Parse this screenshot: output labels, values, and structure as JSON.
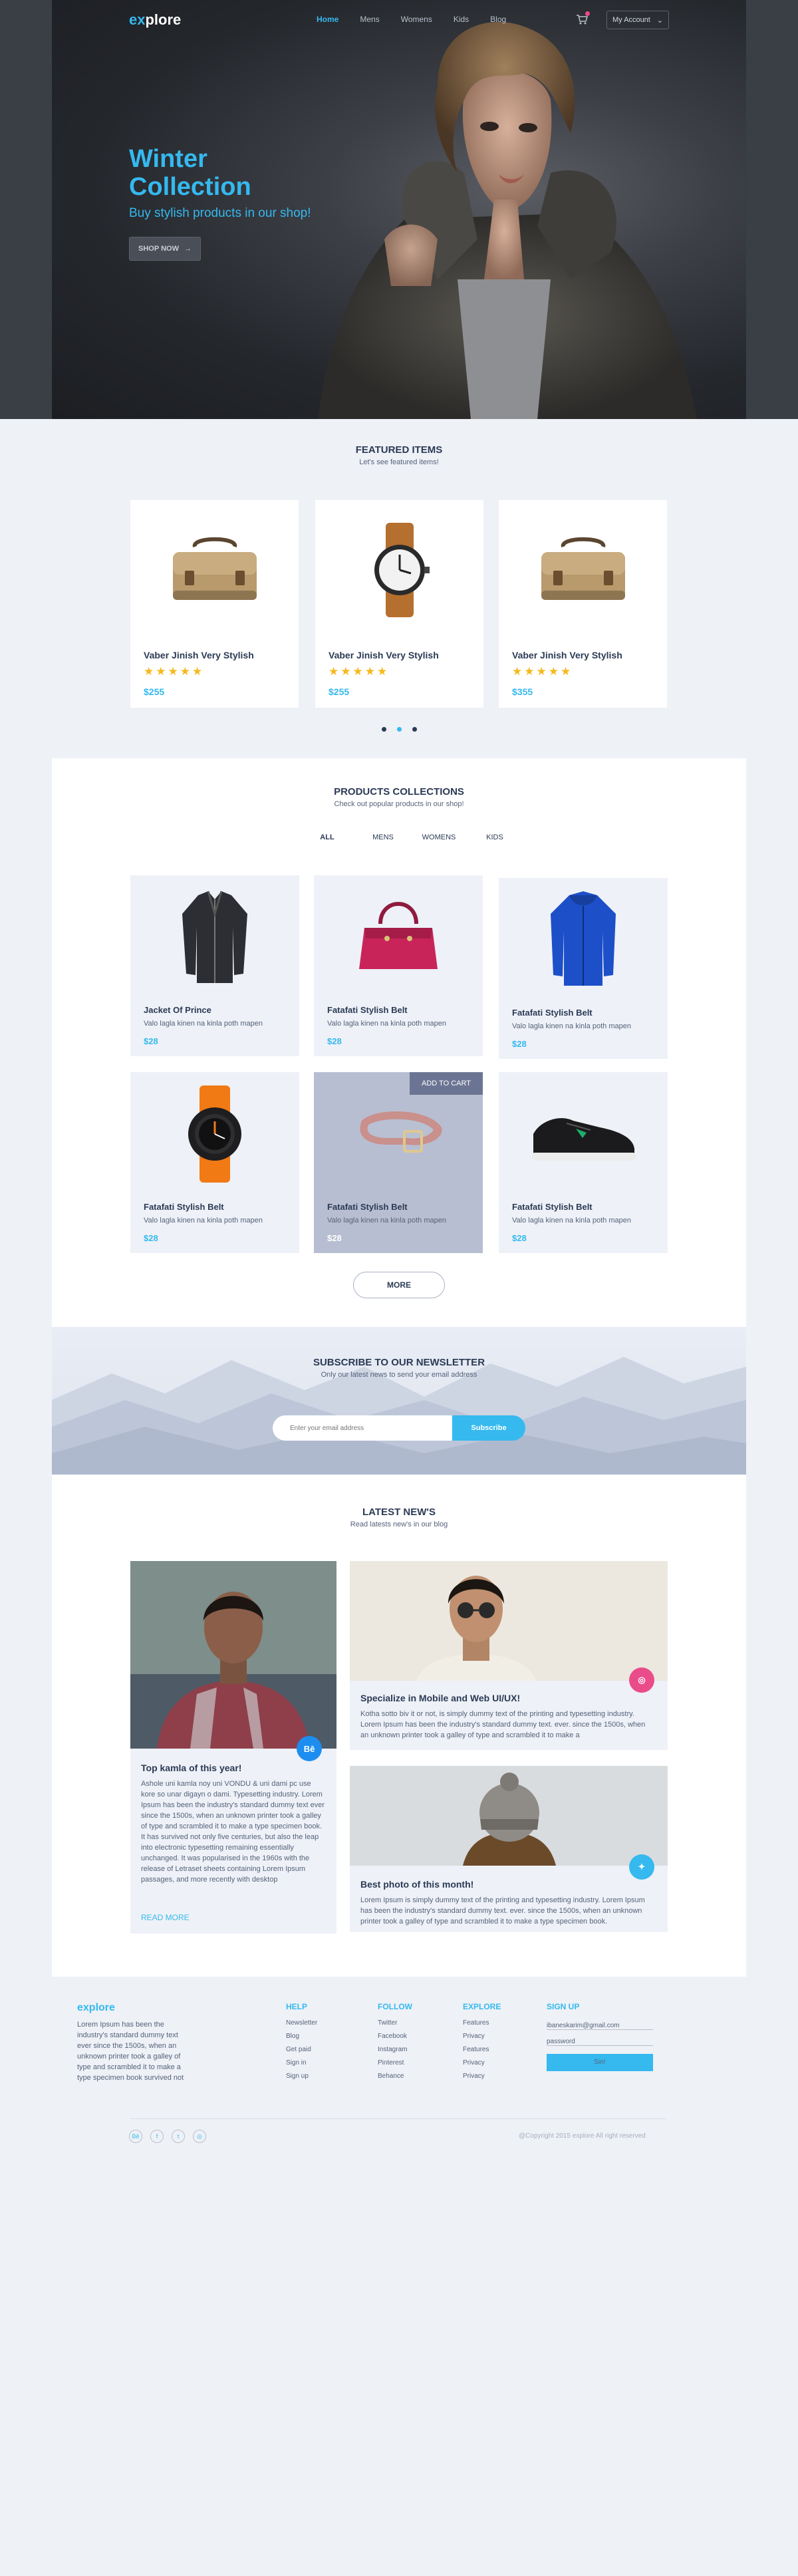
{
  "nav": {
    "logo_a": "ex",
    "logo_b": "plore",
    "links": [
      "Home",
      "Mens",
      "Womens",
      "Kids",
      "Blog"
    ],
    "account": "My Account",
    "account_caret": "⌄"
  },
  "hero": {
    "title_line1": "Winter",
    "title_line2": "Collection",
    "subtitle": "Buy stylish products in our shop!",
    "button": "SHOP NOW",
    "button_arrow": "→"
  },
  "featured": {
    "title": "FEATURED ITEMS",
    "subtitle": "Let's see featured items!",
    "items": [
      {
        "name": "Vaber Jinish Very Stylish",
        "stars": "★★★★★",
        "rating": 5,
        "price": "$255",
        "icon": "messenger-bag-icon"
      },
      {
        "name": "Vaber Jinish Very Stylish",
        "stars": "★★★★★",
        "rating": 5,
        "price": "$255",
        "icon": "wristwatch-icon"
      },
      {
        "name": "Vaber Jinish Very Stylish",
        "stars": "★★★★★",
        "rating": 5,
        "price": "$355",
        "icon": "messenger-bag-icon"
      }
    ],
    "active_dot": 2
  },
  "products": {
    "title": "PRODUCTS COLLECTIONS",
    "subtitle": "Check out popular products in our shop!",
    "filters": [
      "ALL",
      "MENS",
      "WOMENS",
      "KIDS"
    ],
    "add_to_cart": "ADD TO CART",
    "more": "MORE",
    "items": [
      {
        "name": "Jacket Of Prince",
        "desc": "Valo lagla kinen na kinla poth mapen",
        "price": "$28",
        "icon": "leather-jacket-icon"
      },
      {
        "name": "Fatafati Stylish Belt",
        "desc": "Valo lagla kinen na kinla poth mapen",
        "price": "$28",
        "icon": "handbag-icon"
      },
      {
        "name": "Fatafati Stylish Belt",
        "desc": "Valo lagla kinen na kinla poth mapen",
        "price": "$28",
        "icon": "blue-jacket-icon"
      },
      {
        "name": "Fatafati Stylish Belt",
        "desc": "Valo lagla kinen na kinla poth mapen",
        "price": "$28",
        "icon": "sport-watch-icon"
      },
      {
        "name": "Fatafati Stylish Belt",
        "desc": "Valo lagla kinen na kinla poth mapen",
        "price": "$28",
        "icon": "belt-icon"
      },
      {
        "name": "Fatafati Stylish Belt",
        "desc": "Valo lagla kinen na kinla poth mapen",
        "price": "$28",
        "icon": "sneaker-icon"
      }
    ]
  },
  "newsletter": {
    "title": "SUBSCRIBE TO OUR NEWSLETTER",
    "subtitle": "Only our latest news to send your email address",
    "placeholder": "Enter your email address",
    "button": "Subscribe"
  },
  "news": {
    "title": "LATEST NEW'S",
    "subtitle": "Read latests new's in our blog",
    "posts": [
      {
        "title": "Top kamla of this year!",
        "body": "Ashole uni kamla noy uni VONDU & uni dami pc use kore so unar digayn o dami. Typesetting industry. Lorem Ipsum has been the industry's standard dummy text ever since the 1500s, when an unknown printer took a galley of type and scrambled it to make a type specimen book. It has survived not only five centuries, but also the leap into electronic typesetting remaining essentially unchanged. It was popularised in the 1960s with the release of Letraset sheets containing Lorem Ipsum passages, and more recently with desktop",
        "badge": "Bē",
        "read_more": "READ MORE"
      },
      {
        "title": "Specialize in Mobile and Web UI/UX!",
        "body": "Kotha sotto biv it or not, is simply dummy text of the printing and typesetting industry. Lorem Ipsum has been the industry's standard dummy text. ever. since the 1500s, when an unknown printer took a galley of type and scrambled it to make a",
        "badge": "◎"
      },
      {
        "title": "Best photo of this month!",
        "body": "Lorem Ipsum is simply dummy text of the printing and typesetting industry. Lorem Ipsum has been the industry's standard dummy text. ever. since the 1500s, when an unknown printer took a galley of type and scrambled it to make a type specimen book.",
        "badge": "✦"
      }
    ]
  },
  "footer": {
    "logo": "explore",
    "about": "Lorem Ipsum has been the industry's standard dummy text ever since the 1500s, when an unknown printer took a galley of type and scrambled it to make a type specimen book survived not",
    "help": {
      "title": "HELP",
      "items": [
        "Newsletter",
        "Blog",
        "Get paid",
        "Sign in",
        "Sign up"
      ]
    },
    "follow": {
      "title": "FOLLOW",
      "items": [
        "Twitter",
        "Facebook",
        "Instagram",
        "Pinterest",
        "Behance"
      ]
    },
    "explore": {
      "title": "EXPLORE",
      "items": [
        "Features",
        "Privacy",
        "Features",
        "Privacy",
        "Privacy"
      ]
    },
    "signup": {
      "title": "SIGN UP",
      "email": "ibaneskarim@gmail.com",
      "password": "password",
      "button": "Sin!"
    },
    "socials": [
      "Bē",
      "f",
      "t",
      "◎"
    ],
    "copyright": "@Copyright 2015 explore All right reserved"
  },
  "colors": {
    "accent": "#35b9ef",
    "star": "#f6b91a",
    "dark": "#2b3a55",
    "pink": "#f0468c"
  }
}
